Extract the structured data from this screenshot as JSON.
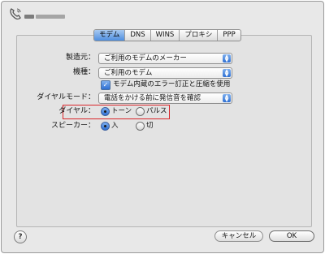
{
  "tabs": [
    "モデム",
    "DNS",
    "WINS",
    "プロキシ",
    "PPP"
  ],
  "fields": {
    "manufacturer": {
      "label": "製造元：",
      "value": "ご利用のモデムのメーカー"
    },
    "model": {
      "label": "機種：",
      "value": "ご利用のモデム"
    },
    "error_correction": {
      "label": "モデム内蔵のエラー訂正と圧縮を使用",
      "checked": true
    },
    "dial_mode": {
      "label": "ダイヤルモード：",
      "value": "電話をかける前に発信音を確認"
    },
    "dialing": {
      "label": "ダイヤル：",
      "options": [
        "トーン",
        "パルス"
      ],
      "selected": "トーン"
    },
    "speaker": {
      "label": "スピーカー：",
      "options": [
        "入",
        "切"
      ],
      "selected": "入"
    }
  },
  "buttons": {
    "help": "?",
    "cancel": "キャンセル",
    "ok": "OK"
  },
  "colors": {
    "accent": "#3b7be0",
    "highlight_box": "#d9262b"
  }
}
